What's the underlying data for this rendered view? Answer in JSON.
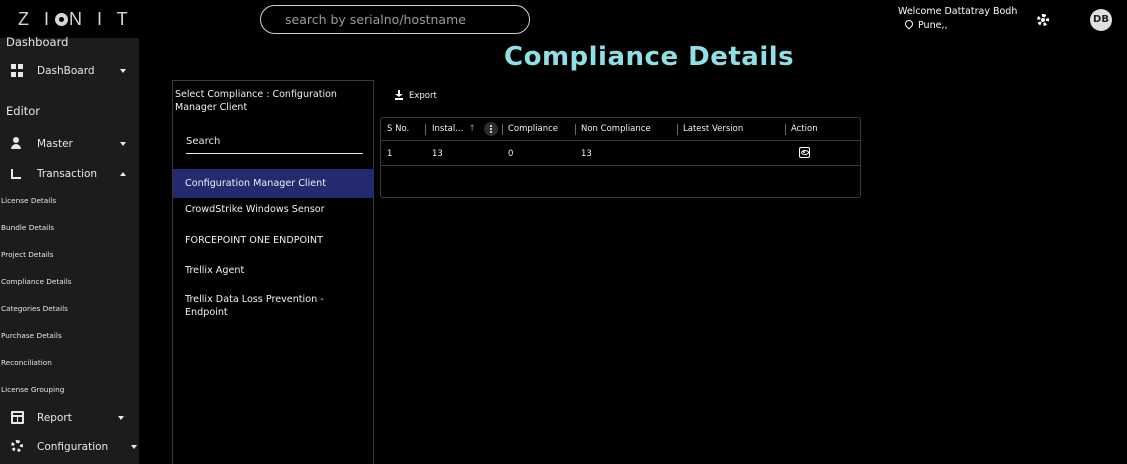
{
  "header": {
    "logo_text": "ZIONIT",
    "search_placeholder": "search by serialno/hostname",
    "welcome_text": "Welcome Dattatray Bodh",
    "location_text": "Pune,,",
    "avatar_initials": "DB",
    "settings_icon": "settings-icon"
  },
  "sidebar": {
    "dashboard_heading": "Dashboard",
    "editor_heading": "Editor",
    "items": [
      {
        "label": "DashBoard",
        "icon": "dashboard-add-icon",
        "caret": "down"
      },
      {
        "label": "Master",
        "icon": "user-group-icon",
        "caret": "down"
      },
      {
        "label": "Transaction",
        "icon": "crop-icon",
        "caret": "up"
      },
      {
        "label": "Report",
        "icon": "table-icon",
        "caret": "down"
      },
      {
        "label": "Configuration",
        "icon": "gear-icon",
        "caret": "down"
      }
    ],
    "sublinks": [
      "License Details",
      "Bundle Details",
      "Project Details",
      "Compliance Details",
      "Categories Details",
      "Purchase Details",
      "Reconciliation",
      "License Grouping"
    ]
  },
  "main": {
    "title": "Compliance Details",
    "select_label": "Select Compliance : Configuration Manager Client",
    "list_search_placeholder": "Search",
    "compliance_list": [
      {
        "label": "Configuration Manager Client",
        "selected": true
      },
      {
        "label": "CrowdStrike Windows Sensor",
        "selected": false
      },
      {
        "label": "FORCEPOINT ONE ENDPOINT",
        "selected": false
      },
      {
        "label": "Trellix Agent",
        "selected": false
      },
      {
        "label": "Trellix Data Loss Prevention - Endpoint",
        "selected": false
      }
    ],
    "export_label": "Export",
    "table": {
      "columns": [
        "S No.",
        "Instal...",
        "Compliance",
        "Non Compliance",
        "Latest Version",
        "Action"
      ],
      "sort_indicator": "↑",
      "rows": [
        {
          "sno": "1",
          "installed": "13",
          "compliance": "0",
          "non_compliance": "13",
          "latest_version": "",
          "action_icon": "view-icon"
        }
      ]
    }
  }
}
